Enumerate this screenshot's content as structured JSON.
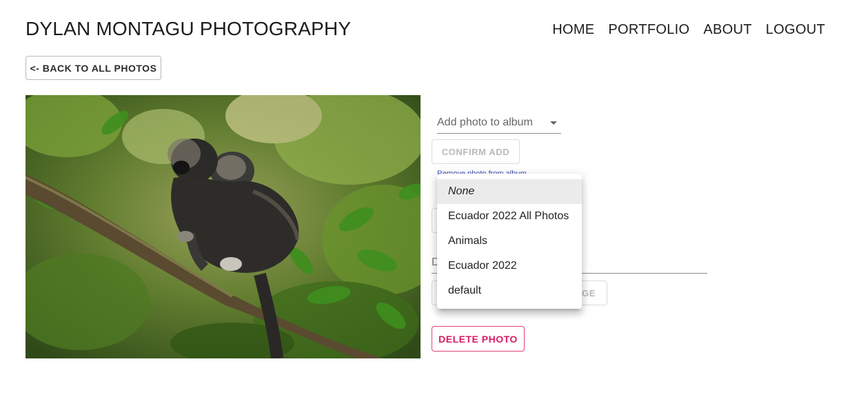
{
  "header": {
    "brand": "DYLAN MONTAGU PHOTOGRAPHY",
    "nav": [
      "HOME",
      "PORTFOLIO",
      "ABOUT",
      "LOGOUT"
    ]
  },
  "back_button": "<- BACK TO ALL PHOTOS",
  "photo": {
    "subject": "monkey-on-branch"
  },
  "album_form": {
    "select_placeholder": "Add photo to album",
    "confirm_label": "CONFIRM ADD",
    "remove_label": "Remove photo from album",
    "description_label": "D",
    "change_label": "GE",
    "delete_label": "DELETE PHOTO"
  },
  "album_menu": {
    "options": [
      "None",
      "Ecuador 2022 All Photos",
      "Animals",
      "Ecuador 2022",
      "default"
    ],
    "highlighted": "None"
  },
  "colors": {
    "accent_delete": "#d81b60",
    "link": "#3f51b5"
  }
}
